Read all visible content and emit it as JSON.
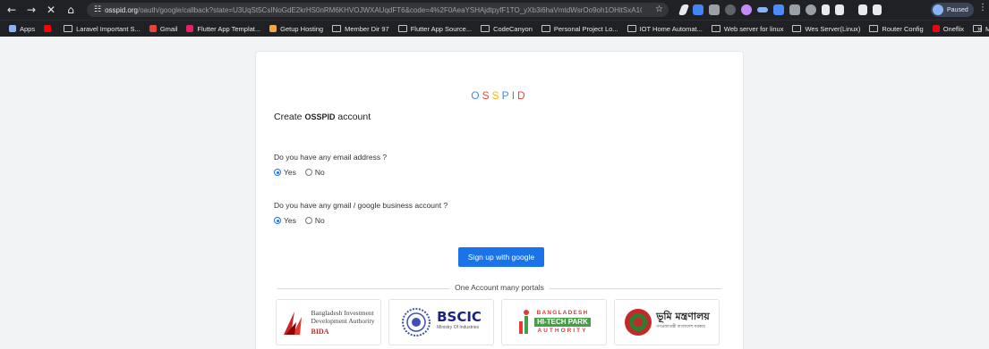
{
  "browser": {
    "url_host": "osspid.org",
    "url_path": "/oauth/google/callback?state=U3UqSt5CsINoGdE2krHS0nRM6KHVOJWXAUqdFT6&code=4%2F0AeaYSHAjdtpyfF1TO_yXb3i6haVmtdWsrOo9oh1OHitSxA1GM...",
    "profile_status": "Paused",
    "icons": [
      "back-icon",
      "forward-icon",
      "close-icon",
      "home-icon",
      "site-settings-icon",
      "star-icon",
      "menu-icon"
    ]
  },
  "bookmarks": [
    {
      "label": "Apps",
      "icon": "grid",
      "color": "#8ab4f8"
    },
    {
      "label": "",
      "icon": "youtube",
      "color": "#ff0000"
    },
    {
      "label": "Laravel Important S...",
      "icon": "folder"
    },
    {
      "label": "Gmail",
      "icon": "gmail",
      "color": "#ea4335"
    },
    {
      "label": "Flutter App Templat...",
      "icon": "site",
      "color": "#e91e63"
    },
    {
      "label": "Getup Hosting",
      "icon": "site",
      "color": "#f4a742"
    },
    {
      "label": "Member Dir 97",
      "icon": "folder"
    },
    {
      "label": "Flutter App Source...",
      "icon": "folder"
    },
    {
      "label": "CodeCanyon",
      "icon": "folder"
    },
    {
      "label": "Personal Project Lo...",
      "icon": "folder"
    },
    {
      "label": "IOT Home Automat...",
      "icon": "folder"
    },
    {
      "label": "Web server for linux",
      "icon": "folder"
    },
    {
      "label": "Wes Server(Linux)",
      "icon": "folder"
    },
    {
      "label": "Router Config",
      "icon": "folder"
    },
    {
      "label": "Oneflix",
      "icon": "site",
      "color": "#e50914"
    },
    {
      "label": "My Journal",
      "icon": "folder"
    }
  ],
  "page": {
    "brand": "OSSPID",
    "brand_colors": [
      "#4285f4",
      "#ea4335",
      "#fbbc05",
      "#4285f4",
      "#34a853",
      "#ea4335"
    ],
    "create_prefix": "Create ",
    "create_brand": "OSSPID",
    "create_suffix": " account",
    "q1": "Do you have any email address ?",
    "q2": "Do you have any gmail / google business account ?",
    "yes": "Yes",
    "no": "No",
    "q1_selected": "Yes",
    "q2_selected": "Yes",
    "signup_button": "Sign up with google",
    "portals_label": "One Account many portals",
    "logos": {
      "bida_line1": "Bangladesh Investment",
      "bida_line2": "Development Authority",
      "bida_abbr": "BIDA",
      "bscic": "BSCIC",
      "bscic_sub": "Ministry Of Industries",
      "hitech_1": "BANGLADESH",
      "hitech_2": "HI-TECH PARK",
      "hitech_3": "AUTHORITY",
      "bhumi": "ভূমি মন্ত্রণালয়",
      "bhumi_sub": "গণপ্রজাতন্ত্রী বাংলাদেশ সরকার"
    },
    "accent": "#1a73e8"
  }
}
